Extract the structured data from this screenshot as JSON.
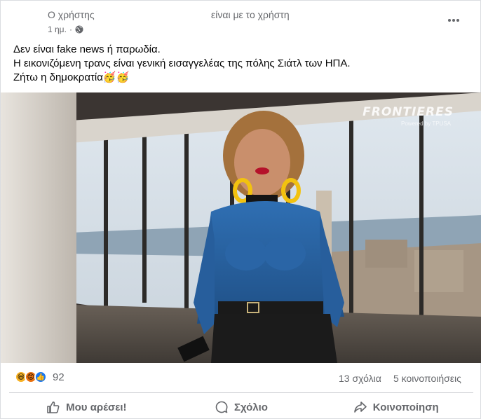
{
  "post": {
    "author": "Ο χρήστης",
    "shared_note": "είναι με το χρήστη",
    "time": "1 ημ.",
    "privacy_icon": "globe-icon",
    "more_icon": "more-options-icon",
    "text_lines": [
      "Δεν είναι fake news ή παρωδία.",
      "Η εικονιζόμενη τρανς είναι γενική εισαγγελέας της πόλης Σιάτλ των ΗΠΑ.",
      "Ζήτω η δημοκρατία🥳🥳"
    ]
  },
  "media": {
    "watermark": "FRONTIERES",
    "watermark_sub": "Powered by TPUSA"
  },
  "stats": {
    "reaction_icons": [
      "haha-icon",
      "angry-icon",
      "like-icon"
    ],
    "reaction_count": "92",
    "comments": "13 σχόλια",
    "shares": "5 κοινοποιήσεις"
  },
  "actions": {
    "like": "Μου αρέσει!",
    "comment": "Σχόλιο",
    "share": "Κοινοποίηση"
  },
  "colors": {
    "accent": "#1877f2",
    "secondary_text": "#65676b",
    "divider": "#ced0d4"
  }
}
